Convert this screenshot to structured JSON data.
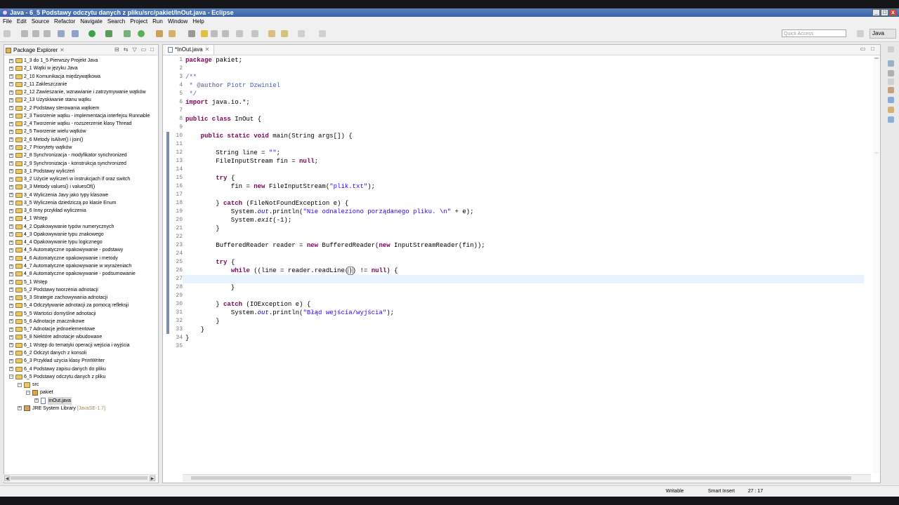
{
  "window": {
    "title": "Java - 6_5 Podstawy odczytu danych z pliku/src/pakiet/InOut.java - Eclipse"
  },
  "menu": [
    "File",
    "Edit",
    "Source",
    "Refactor",
    "Navigate",
    "Search",
    "Project",
    "Run",
    "Window",
    "Help"
  ],
  "toolbar": {
    "quick_access_placeholder": "Quick Access",
    "perspective_label": "Java"
  },
  "package_explorer": {
    "title": "Package Explorer",
    "close_glyph": "✕",
    "projects": [
      "1_3 do 1_5 Pierwszy Projekt Java",
      "2_1 Wątki w języku Java",
      "2_10 Komunikacja międzywątkowa",
      "2_11 Zakleszczanie",
      "2_12 Zawieszanie, wznawianie i zatrzymywanie wątków",
      "2_13 Uzyskiwanie stanu wątku",
      "2_2 Podstawy sterowania wątkiem",
      "2_3 Tworzenie wątku - implementacja interfejsu Runnable",
      "2_4 Tworzenie wątku - rozszerzenie klasy Thread",
      "2_5 Tworzenie wielu wątków",
      "2_6 Metody isAlive() i join()",
      "2_7 Priorytety wątków",
      "2_8 Synchronizacja - modyfikator synchronized",
      "2_9 Synchronizacja - konstrukcja synchronized",
      "3_1 Podstawy wyliczeń",
      "3_2 Użycie wyliczeń w instrukcjach if oraz switch",
      "3_3 Metody values() i valuesOf()",
      "3_4 Wyliczenia Javy jako typy klasowe",
      "3_5 Wyliczenia dziedziczą po klasie Enum",
      "3_6 Inny przykład wyliczenia",
      "4_1 Wstęp",
      "4_2 Opakowywanie typów numerycznych",
      "4_3 Opakowywanie typu znakowego",
      "4_4 Opakowywanie typu logicznego",
      "4_5 Automatyczne opakowywanie - podstawy",
      "4_6 Automatyczne opakowywanie i metody",
      "4_7 Automatyczne opakowywanie w wyrażeniach",
      "4_8 Automatyczne opakowywanie - podsumowanie",
      "5_1 Wstęp",
      "5_2 Podstawy tworzenia adnotacji",
      "5_3 Strategie zachowywania adnotacji",
      "5_4 Odczytywanie adnotacji za pomocą refleksji",
      "5_5 Wartości domyślne adnotacji",
      "5_6 Adnotacje znacznikowe",
      "5_7 Adnotacje jednoelementowe",
      "5_8 Niektóre adnotacje wbudowane",
      "6_1 Wstęp do tematyki operacji wejścia i wyjścia",
      "6_2 Odczyt danych z konsoli",
      "6_3 Przykład użycia klasy PrintWriter",
      "6_4 Podstawy zapisu danych do pliku",
      "6_5 Podstawy odczytu danych z pliku"
    ],
    "open_project_children": {
      "src": "src",
      "package": "pakiet",
      "file": "InOut.java",
      "jre": "JRE System Library",
      "jre_version": "[JavaSE-1.7]"
    }
  },
  "editor": {
    "tab_label": "*InOut.java",
    "tab_close": "✕",
    "line_numbers": [
      "1",
      "2",
      "3",
      "4",
      "5",
      "6",
      "7",
      "8",
      "9",
      "10",
      "11",
      "12",
      "13",
      "14",
      "15",
      "16",
      "17",
      "18",
      "19",
      "20",
      "21",
      "22",
      "23",
      "24",
      "25",
      "26",
      "27",
      "28",
      "29",
      "30",
      "31",
      "32",
      "33",
      "34",
      "35"
    ]
  },
  "status": {
    "writable": "Writable",
    "insert_mode": "Smart Insert",
    "position": "27 : 17"
  }
}
